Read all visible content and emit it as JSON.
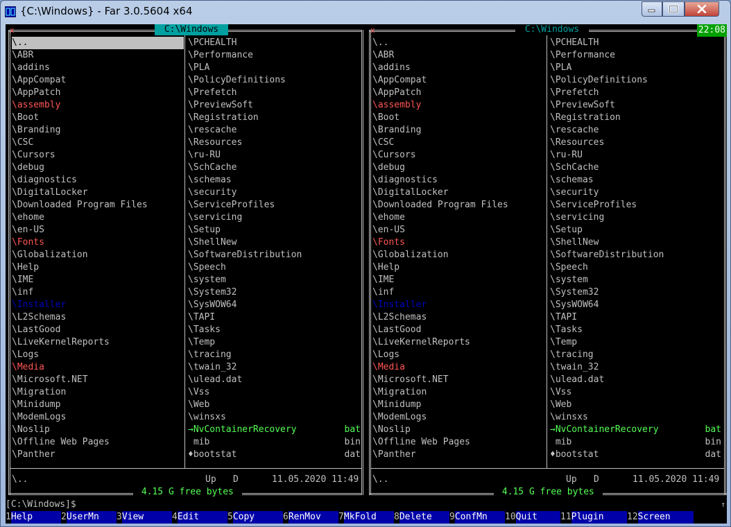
{
  "window": {
    "title": "{C:\\Windows} - Far 3.0.5604 x64"
  },
  "clock": "22:08",
  "left_panel": {
    "path": " C:\\Windows ",
    "col1": [
      {
        "name": "\\..",
        "kind": "cursor"
      },
      {
        "name": "\\ABR",
        "kind": "dir"
      },
      {
        "name": "\\addins",
        "kind": "dir"
      },
      {
        "name": "\\AppCompat",
        "kind": "dir"
      },
      {
        "name": "\\AppPatch",
        "kind": "dir"
      },
      {
        "name": "\\assembly",
        "kind": "red"
      },
      {
        "name": "\\Boot",
        "kind": "dir"
      },
      {
        "name": "\\Branding",
        "kind": "dir"
      },
      {
        "name": "\\CSC",
        "kind": "dir"
      },
      {
        "name": "\\Cursors",
        "kind": "dir"
      },
      {
        "name": "\\debug",
        "kind": "dir"
      },
      {
        "name": "\\diagnostics",
        "kind": "dir"
      },
      {
        "name": "\\DigitalLocker",
        "kind": "dir"
      },
      {
        "name": "\\Downloaded Program Files",
        "kind": "dir"
      },
      {
        "name": "\\ehome",
        "kind": "dir"
      },
      {
        "name": "\\en-US",
        "kind": "dir"
      },
      {
        "name": "\\Fonts",
        "kind": "red"
      },
      {
        "name": "\\Globalization",
        "kind": "dir"
      },
      {
        "name": "\\Help",
        "kind": "dir"
      },
      {
        "name": "\\IME",
        "kind": "dir"
      },
      {
        "name": "\\inf",
        "kind": "dir"
      },
      {
        "name": "\\Installer",
        "kind": "blue"
      },
      {
        "name": "\\L2Schemas",
        "kind": "dir"
      },
      {
        "name": "\\LastGood",
        "kind": "dir"
      },
      {
        "name": "\\LiveKernelReports",
        "kind": "dir"
      },
      {
        "name": "\\Logs",
        "kind": "dir"
      },
      {
        "name": "\\Media",
        "kind": "red"
      },
      {
        "name": "\\Microsoft.NET",
        "kind": "dir"
      },
      {
        "name": "\\Migration",
        "kind": "dir"
      },
      {
        "name": "\\Minidump",
        "kind": "dir"
      },
      {
        "name": "\\ModemLogs",
        "kind": "dir"
      },
      {
        "name": "\\Noslip",
        "kind": "dir"
      },
      {
        "name": "\\Offline Web Pages",
        "kind": "dir"
      },
      {
        "name": "\\Panther",
        "kind": "dir"
      }
    ],
    "col2": [
      {
        "name": "\\PCHEALTH",
        "ext": "",
        "kind": "dir"
      },
      {
        "name": "\\Performance",
        "ext": "",
        "kind": "dir"
      },
      {
        "name": "\\PLA",
        "ext": "",
        "kind": "dir"
      },
      {
        "name": "\\PolicyDefinitions",
        "ext": "",
        "kind": "dir"
      },
      {
        "name": "\\Prefetch",
        "ext": "",
        "kind": "dir"
      },
      {
        "name": "\\PreviewSoft",
        "ext": "",
        "kind": "dir"
      },
      {
        "name": "\\Registration",
        "ext": "",
        "kind": "dir"
      },
      {
        "name": "\\rescache",
        "ext": "",
        "kind": "dir"
      },
      {
        "name": "\\Resources",
        "ext": "",
        "kind": "dir"
      },
      {
        "name": "\\ru-RU",
        "ext": "",
        "kind": "dir"
      },
      {
        "name": "\\SchCache",
        "ext": "",
        "kind": "dir"
      },
      {
        "name": "\\schemas",
        "ext": "",
        "kind": "dir"
      },
      {
        "name": "\\security",
        "ext": "",
        "kind": "dir"
      },
      {
        "name": "\\ServiceProfiles",
        "ext": "",
        "kind": "dir"
      },
      {
        "name": "\\servicing",
        "ext": "",
        "kind": "dir"
      },
      {
        "name": "\\Setup",
        "ext": "",
        "kind": "dir"
      },
      {
        "name": "\\ShellNew",
        "ext": "",
        "kind": "dir"
      },
      {
        "name": "\\SoftwareDistribution",
        "ext": "",
        "kind": "dir"
      },
      {
        "name": "\\Speech",
        "ext": "",
        "kind": "dir"
      },
      {
        "name": "\\system",
        "ext": "",
        "kind": "dir"
      },
      {
        "name": "\\System32",
        "ext": "",
        "kind": "dir"
      },
      {
        "name": "\\SysWOW64",
        "ext": "",
        "kind": "dir"
      },
      {
        "name": "\\TAPI",
        "ext": "",
        "kind": "dir"
      },
      {
        "name": "\\Tasks",
        "ext": "",
        "kind": "dir"
      },
      {
        "name": "\\Temp",
        "ext": "",
        "kind": "dir"
      },
      {
        "name": "\\tracing",
        "ext": "",
        "kind": "dir"
      },
      {
        "name": "\\twain_32",
        "ext": "",
        "kind": "dir"
      },
      {
        "name": "\\ulead.dat",
        "ext": "",
        "kind": "dir"
      },
      {
        "name": "\\Vss",
        "ext": "",
        "kind": "dir"
      },
      {
        "name": "\\Web",
        "ext": "",
        "kind": "dir"
      },
      {
        "name": "\\winsxs",
        "ext": "",
        "kind": "dir"
      },
      {
        "name": "→NvContainerRecovery",
        "ext": "bat",
        "kind": "green"
      },
      {
        "name": " mib",
        "ext": "bin",
        "kind": "grey"
      },
      {
        "name": "♦bootstat",
        "ext": "dat",
        "kind": "grey"
      }
    ],
    "status": {
      "name": "\\..",
      "type": "Up",
      "attr": "D",
      "date": "11.05.2020 11:49"
    },
    "free": " 4.15 G free bytes "
  },
  "right_panel": {
    "path": " C:\\Windows ",
    "status": {
      "name": "\\..",
      "type": "Up",
      "attr": "D",
      "date": "11.05.2020 11:49"
    },
    "free": " 4.15 G free bytes "
  },
  "cmdline": "[C:\\Windows]$",
  "scroll_marker": "↑",
  "keybar": [
    {
      "num": "1",
      "label": "Help"
    },
    {
      "num": "2",
      "label": "UserMn"
    },
    {
      "num": "3",
      "label": "View"
    },
    {
      "num": "4",
      "label": "Edit"
    },
    {
      "num": "5",
      "label": "Copy"
    },
    {
      "num": "6",
      "label": "RenMov"
    },
    {
      "num": "7",
      "label": "MkFold"
    },
    {
      "num": "8",
      "label": "Delete"
    },
    {
      "num": "9",
      "label": "ConfMn"
    },
    {
      "num": "10",
      "label": "Quit"
    },
    {
      "num": "11",
      "label": "Plugin"
    },
    {
      "num": "12",
      "label": "Screen"
    }
  ],
  "closebox_glyph": "x",
  "icons": {
    "app": "far-manager-icon",
    "minimize": "minimize-icon",
    "maximize": "maximize-icon",
    "close": "close-icon"
  }
}
